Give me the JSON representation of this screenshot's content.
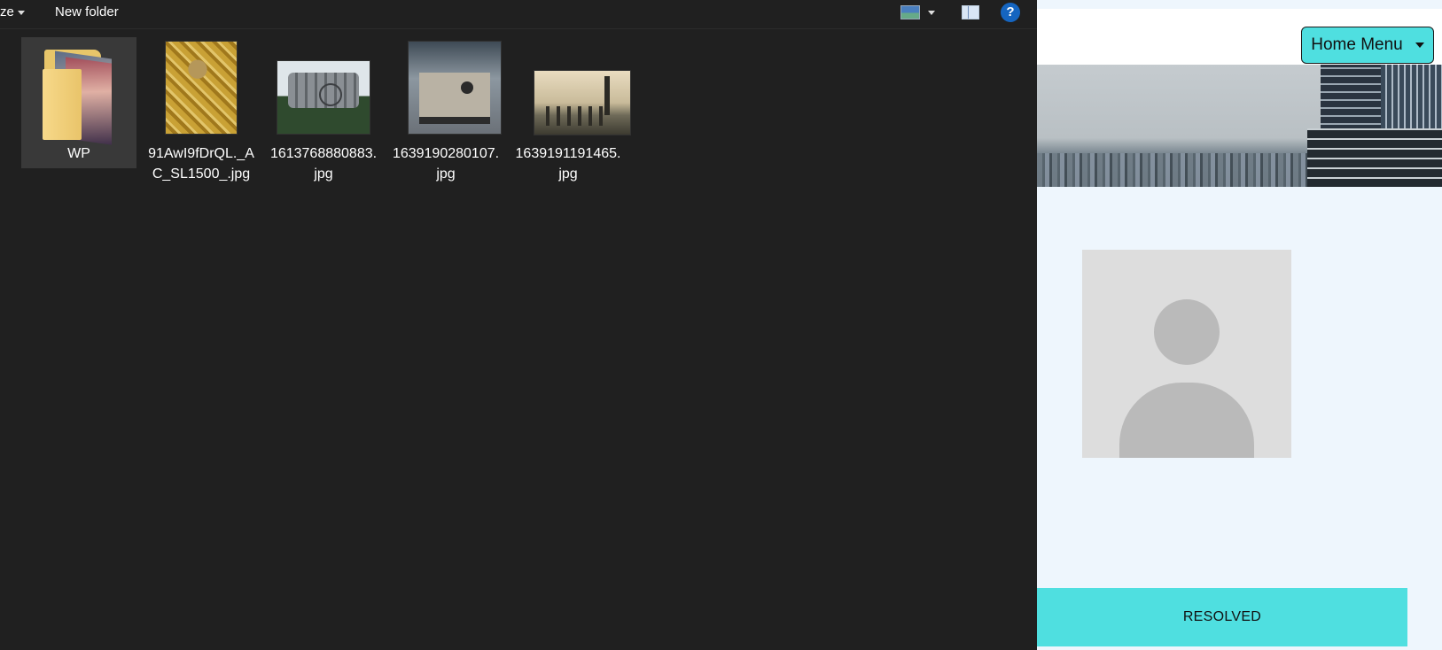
{
  "explorer": {
    "toolbar": {
      "size_label": "ze",
      "new_folder_label": "New folder",
      "view_icon": "view-icon",
      "pane_icon": "preview-pane-icon",
      "help_label": "?"
    },
    "files": [
      {
        "name": "WP",
        "type": "folder",
        "selected": true
      },
      {
        "name": "91AwI9fDrQL._AC_SL1500_.jpg",
        "type": "image"
      },
      {
        "name": "1613768880883.jpg",
        "type": "image"
      },
      {
        "name": "1639190280107.jpg",
        "type": "image"
      },
      {
        "name": "1639191191465.jpg",
        "type": "image"
      }
    ]
  },
  "web": {
    "menu_label": "Home Menu",
    "status_label": "RESOLVED",
    "accent_color": "#4fdfe0",
    "page_bg": "#eef6fd"
  }
}
